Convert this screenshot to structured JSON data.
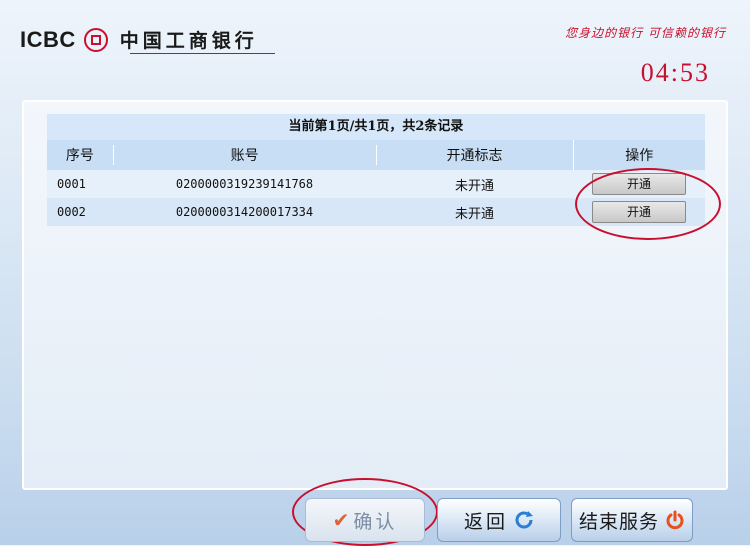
{
  "header": {
    "logo_text": "ICBC",
    "bank_name": "中国工商银行",
    "slogan": "您身边的银行 可信赖的银行",
    "timer": "04:53"
  },
  "table": {
    "page_info": "当前第1页/共1页，共2条记录",
    "columns": [
      "序号",
      "账号",
      "开通标志",
      "操作"
    ],
    "rows": [
      {
        "no": "0001",
        "account": "0200000319239141768",
        "status": "未开通",
        "action": "开通"
      },
      {
        "no": "0002",
        "account": "0200000314200017334",
        "status": "未开通",
        "action": "开通"
      }
    ]
  },
  "buttons": {
    "confirm": "确认",
    "back": "返回",
    "end": "结束服务"
  },
  "colors": {
    "brand_red": "#c8102e",
    "refresh_blue": "#2a7fd4",
    "power_orange": "#e8501e"
  },
  "icons": [
    "icbc-logo-icon",
    "check-icon",
    "refresh-icon",
    "power-icon"
  ]
}
